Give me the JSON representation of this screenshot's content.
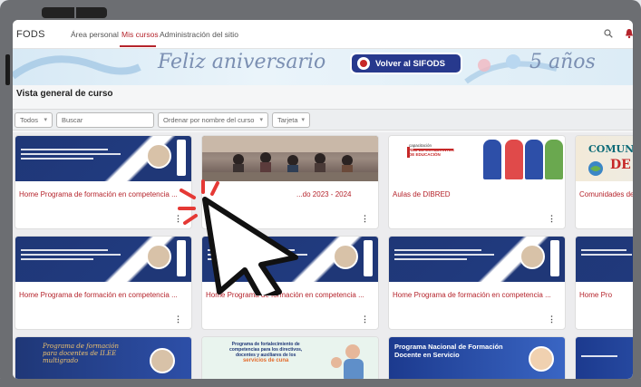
{
  "navbar": {
    "brand": "FODS",
    "links": [
      "Área personal",
      "Mis cursos",
      "Administración del sitio"
    ],
    "active_index": 1
  },
  "banner": {
    "text_left": "Feliz aniversario",
    "button_label": "Volver al SIFODS",
    "text_right": "5 años"
  },
  "page": {
    "section_title": "Vista general de curso"
  },
  "filters": {
    "status": "Todos",
    "search_placeholder": "Buscar",
    "sort": "Ordenar por nombre del curso",
    "view": "Tarjeta"
  },
  "courses": {
    "row1": [
      {
        "title": "Home Programa de formación en competencia ...",
        "thumb": "navy"
      },
      {
        "title": "...do 2023 - 2024",
        "thumb": "photo"
      },
      {
        "title": "Aulas de DIBRED",
        "thumb": "red",
        "thumb_lines": [
          "Programa de",
          "capacitación",
          "RED DE ESTUDIANTES",
          "DE EDUCACIÓN"
        ]
      },
      {
        "title": "Comunidades de",
        "thumb": "beige",
        "thumb_lines": [
          "COMUNIDADE",
          "DE IN"
        ]
      }
    ],
    "row2": [
      {
        "title": "Home Programa de formación en competencia ...",
        "thumb": "navy"
      },
      {
        "title": "Home Programa de formación en competencia ...",
        "thumb": "navy"
      },
      {
        "title": "Home Programa de formación en competencia ...",
        "thumb": "navy"
      },
      {
        "title": "Home Pro",
        "thumb": "navy"
      }
    ],
    "row3": [
      {
        "title": "",
        "thumb": "navy",
        "thumb_lines": [
          "Programa de formación",
          "para docentes de II.EE",
          "multigrado"
        ]
      },
      {
        "title": "",
        "thumb": "teal",
        "thumb_lines": [
          "Programa de fortalecimiento de",
          "competencias para los directivos,",
          "docentes y auxiliares de los",
          "servicios de cuna"
        ]
      },
      {
        "title": "",
        "thumb": "blue",
        "thumb_lines": [
          "Programa Nacional de Formación",
          "Docente en Servicio"
        ]
      },
      {
        "title": "",
        "thumb": "blue"
      }
    ]
  },
  "colors": {
    "accent": "#b5242c",
    "nav_text": "#555555",
    "banner_button": "#27398d",
    "card_title": "#b5242c"
  },
  "icons": {
    "search": "search-icon",
    "notification": "bell-icon",
    "menu": "kebab-menu-icon",
    "cursor": "mouse-pointer-icon"
  }
}
